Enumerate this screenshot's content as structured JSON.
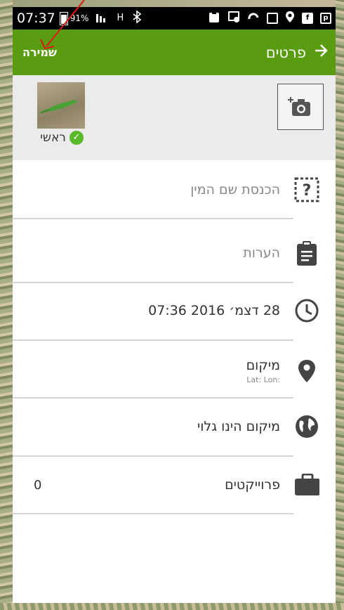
{
  "status_bar": {
    "time": "07:37",
    "battery": "91%",
    "signal_label": "H",
    "icons": [
      "signal-bars-icon",
      "data-h-icon",
      "bluetooth-icon",
      "clipboard-icon",
      "cast-icon",
      "loop-icon",
      "image-icon",
      "location-pin-icon",
      "facebook-icon",
      "p-app-icon"
    ]
  },
  "appbar": {
    "title": "פרטים",
    "save_label": "שמירה",
    "color": "#5a9c11"
  },
  "photo_panel": {
    "primary_label": "ראשי"
  },
  "form": {
    "species_placeholder": "הכנסת שם המין",
    "notes_placeholder": "הערות",
    "datetime": "28 דצמ׳ 2016 07:36",
    "location_label": "מיקום",
    "location_coords": "Lat:  Lon:",
    "location_visibility": "מיקום הינו גלוי",
    "projects_label": "פרוייקטים",
    "projects_count": "0"
  }
}
